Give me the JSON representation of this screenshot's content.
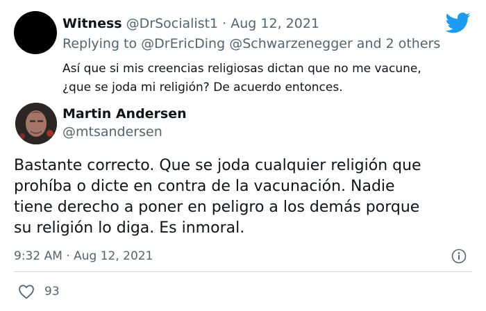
{
  "replied_tweet": {
    "author_name": "Witness",
    "handle": "@DrSocialist1",
    "separator": " · ",
    "date": "Aug 12, 2021",
    "replying_prefix": "Replying to ",
    "replying_to_1": "@DrEricDing",
    "replying_to_2": "@Schwarzenegger",
    "replying_suffix": " and 2 others",
    "text_lines": [
      "Así que si mis creencias religiosas dictan que no me vacune,",
      "¿que se joda mi religión? De acuerdo entonces."
    ]
  },
  "tweet": {
    "author_name": "Martin Andersen",
    "handle": "@mtsandersen",
    "text_lines": [
      "Bastante correcto. Que se joda cualquier religión que",
      "prohíba o dicte en contra de la vacunación. Nadie",
      "tiene derecho a poner en peligro a los demás porque",
      "su religión lo diga. Es inmoral."
    ],
    "time": "9:32 AM",
    "separator": " · ",
    "date": "Aug 12, 2021",
    "like_count": "93"
  },
  "icons": {
    "brand": "twitter-bird-icon",
    "info": "info-icon",
    "like": "heart-icon"
  },
  "colors": {
    "brand_blue": "#1d9bf0",
    "secondary_text": "#536471",
    "primary_text": "#0f1419",
    "divider": "#cfd9de"
  }
}
